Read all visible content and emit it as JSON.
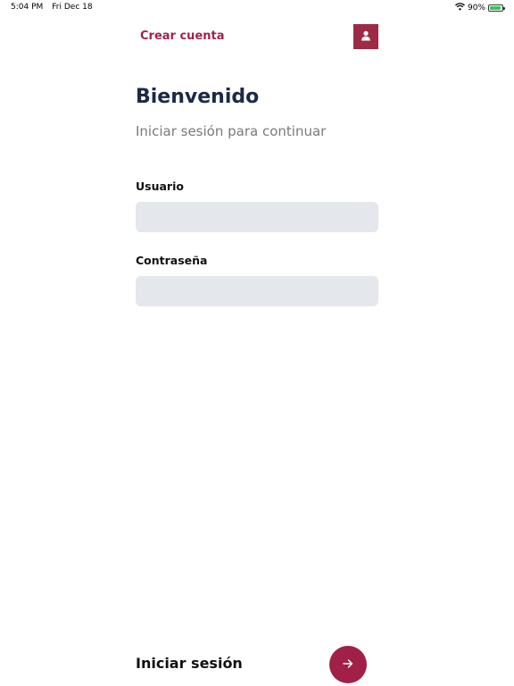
{
  "status_bar": {
    "time": "5:04 PM",
    "date": "Fri Dec 18",
    "battery_percent": "90%",
    "battery_level": 0.9,
    "icons": [
      "wifi-icon",
      "battery-icon"
    ]
  },
  "header": {
    "create_account_label": "Crear cuenta",
    "profile_icon": "user-icon"
  },
  "main": {
    "title": "Bienvenido",
    "subtitle": "Iniciar sesión para continuar",
    "username": {
      "label": "Usuario",
      "value": "",
      "placeholder": ""
    },
    "password": {
      "label": "Contraseña",
      "value": "",
      "placeholder": ""
    }
  },
  "footer": {
    "login_label": "Iniciar sesión",
    "submit_icon": "arrow-right-icon"
  },
  "colors": {
    "accent": "#a02048",
    "title": "#1b2a44",
    "subtitle": "#7a7a7a",
    "input_bg": "#e4e7ec"
  }
}
